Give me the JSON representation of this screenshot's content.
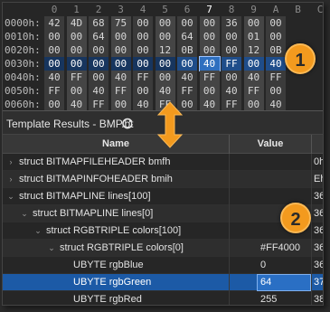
{
  "hex": {
    "columns": [
      "0",
      "1",
      "2",
      "3",
      "4",
      "5",
      "6",
      "7",
      "8",
      "9",
      "A",
      "B",
      "C"
    ],
    "highlight_column": "7",
    "rows": [
      {
        "addr": "0000h:",
        "bytes": [
          "42",
          "4D",
          "68",
          "75",
          "00",
          "00",
          "00",
          "00",
          "36",
          "00",
          "00"
        ]
      },
      {
        "addr": "0010h:",
        "bytes": [
          "00",
          "00",
          "64",
          "00",
          "00",
          "00",
          "64",
          "00",
          "00",
          "01",
          "00"
        ]
      },
      {
        "addr": "0020h:",
        "bytes": [
          "00",
          "00",
          "00",
          "00",
          "00",
          "12",
          "0B",
          "00",
          "00",
          "12",
          "0B"
        ]
      },
      {
        "addr": "0030h:",
        "bytes": [
          "00",
          "00",
          "00",
          "00",
          "00",
          "00",
          "00",
          "40",
          "FF",
          "00",
          "40"
        ]
      },
      {
        "addr": "0040h:",
        "bytes": [
          "40",
          "FF",
          "00",
          "40",
          "FF",
          "00",
          "40",
          "FF",
          "00",
          "40",
          "FF"
        ]
      },
      {
        "addr": "0050h:",
        "bytes": [
          "FF",
          "00",
          "40",
          "FF",
          "00",
          "40",
          "FF",
          "00",
          "40",
          "FF",
          "00"
        ]
      },
      {
        "addr": "0060h:",
        "bytes": [
          "00",
          "40",
          "FF",
          "00",
          "40",
          "FF",
          "00",
          "40",
          "FF",
          "00",
          "40"
        ]
      }
    ]
  },
  "template": {
    "title": "Template Results - BMP.bt",
    "columns": {
      "name": "Name",
      "value": "Value"
    },
    "rows": [
      {
        "name": "struct BITMAPFILEHEADER bmfh",
        "value": "",
        "start": "0h",
        "indent": 0,
        "arrow": "›"
      },
      {
        "name": "struct BITMAPINFOHEADER bmih",
        "value": "",
        "start": "Eh",
        "indent": 0,
        "arrow": "›"
      },
      {
        "name": "struct BITMAPLINE lines[100]",
        "value": "",
        "start": "36h",
        "indent": 0,
        "arrow": "⌄"
      },
      {
        "name": "struct BITMAPLINE lines[0]",
        "value": "",
        "start": "36h",
        "indent": 1,
        "arrow": "⌄"
      },
      {
        "name": "struct RGBTRIPLE colors[100]",
        "value": "",
        "start": "36h",
        "indent": 2,
        "arrow": "⌄"
      },
      {
        "name": "struct RGBTRIPLE colors[0]",
        "value": "#FF4000",
        "start": "36h",
        "indent": 3,
        "arrow": "⌄"
      },
      {
        "name": "UBYTE rgbBlue",
        "value": "0",
        "start": "36h",
        "indent": 4,
        "arrow": ""
      },
      {
        "name": "UBYTE rgbGreen",
        "value": "64",
        "start": "37h",
        "indent": 4,
        "arrow": ""
      },
      {
        "name": "UBYTE rgbRed",
        "value": "255",
        "start": "38h",
        "indent": 4,
        "arrow": ""
      }
    ],
    "selected_row": 7
  },
  "callouts": {
    "one": "1",
    "two": "2"
  },
  "colors": {
    "accent": "#f39a1e",
    "selection": "#1c5aa6",
    "hex_selection": "#2e6fbf"
  }
}
